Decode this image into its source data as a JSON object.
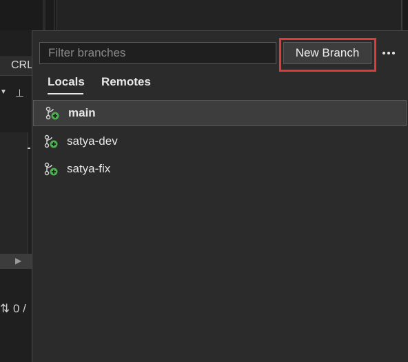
{
  "background": {
    "line_ending": "CRL",
    "status_fragment": "⇅ 0 /"
  },
  "toolbar": {
    "filter_placeholder": "Filter branches",
    "filter_value": "",
    "new_branch_label": "New Branch",
    "more_icon": "ellipsis-icon"
  },
  "tabs": [
    {
      "label": "Locals",
      "active": true
    },
    {
      "label": "Remotes",
      "active": false
    }
  ],
  "branches": [
    {
      "name": "main",
      "current": true,
      "icon": "git-branch-icon"
    },
    {
      "name": "satya-dev",
      "current": false,
      "icon": "git-branch-icon"
    },
    {
      "name": "satya-fix",
      "current": false,
      "icon": "git-branch-icon"
    }
  ],
  "colors": {
    "highlight": "#e53935",
    "branch_icon_badge": "#4caf50",
    "popup_bg": "#2b2b2b"
  }
}
